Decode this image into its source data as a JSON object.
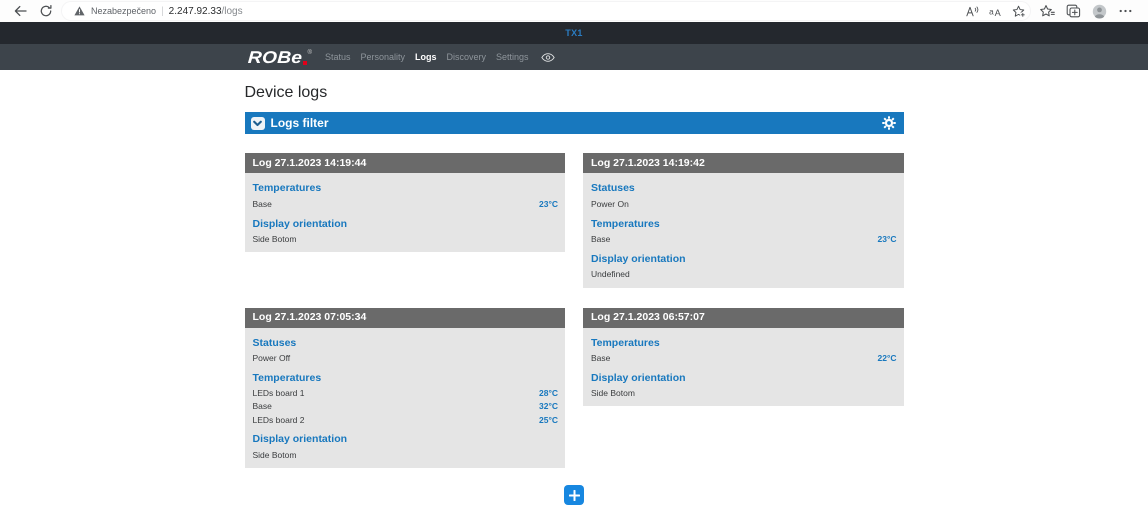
{
  "browser": {
    "security_label": "Nezabezpečeno",
    "url_host": "2.247.92.33",
    "url_path": "/logs"
  },
  "device_header": {
    "label": "TX1"
  },
  "nav": {
    "brand": {
      "text": "ROBe",
      "registered_mark": "®"
    },
    "items": [
      {
        "label": "Status",
        "active": false
      },
      {
        "label": "Personality",
        "active": false
      },
      {
        "label": "Logs",
        "active": true
      },
      {
        "label": "Discovery",
        "active": false
      },
      {
        "label": "Settings",
        "active": false
      }
    ]
  },
  "page": {
    "title": "Device logs"
  },
  "filter": {
    "label": "Logs filter"
  },
  "logs": [
    {
      "title": "Log 27.1.2023 14:19:44",
      "entries": [
        {
          "type": "section",
          "label": "Temperatures"
        },
        {
          "type": "item",
          "name": "Base",
          "value": "23°C"
        },
        {
          "type": "section",
          "label": "Display orientation"
        },
        {
          "type": "item",
          "name": "Side Botom",
          "value": ""
        }
      ]
    },
    {
      "title": "Log 27.1.2023 14:19:42",
      "entries": [
        {
          "type": "section",
          "label": "Statuses"
        },
        {
          "type": "item",
          "name": "Power On",
          "value": ""
        },
        {
          "type": "section",
          "label": "Temperatures"
        },
        {
          "type": "item",
          "name": "Base",
          "value": "23°C"
        },
        {
          "type": "section",
          "label": "Display orientation"
        },
        {
          "type": "item",
          "name": "Undefined",
          "value": ""
        }
      ]
    },
    {
      "title": "Log 27.1.2023 07:05:34",
      "entries": [
        {
          "type": "section",
          "label": "Statuses"
        },
        {
          "type": "item",
          "name": "Power Off",
          "value": ""
        },
        {
          "type": "section",
          "label": "Temperatures"
        },
        {
          "type": "item",
          "name": "LEDs board 1",
          "value": "28°C"
        },
        {
          "type": "item",
          "name": "Base",
          "value": "32°C"
        },
        {
          "type": "item",
          "name": "LEDs board 2",
          "value": "25°C"
        },
        {
          "type": "section",
          "label": "Display orientation"
        },
        {
          "type": "item",
          "name": "Side Botom",
          "value": ""
        }
      ]
    },
    {
      "title": "Log 27.1.2023 06:57:07",
      "entries": [
        {
          "type": "section",
          "label": "Temperatures"
        },
        {
          "type": "item",
          "name": "Base",
          "value": "22°C"
        },
        {
          "type": "section",
          "label": "Display orientation"
        },
        {
          "type": "item",
          "name": "Side Botom",
          "value": ""
        }
      ]
    }
  ],
  "add_button": {
    "label": "+"
  },
  "colors": {
    "accent_blue": "#1878be",
    "add_button_blue": "#1787e0",
    "card_header_gray": "#6a6a6a",
    "card_body_gray": "#e5e5e5",
    "nav_bar_dark": "#3d444b",
    "device_header_black": "#24282e",
    "device_tag_blue": "#2a7cc2"
  }
}
